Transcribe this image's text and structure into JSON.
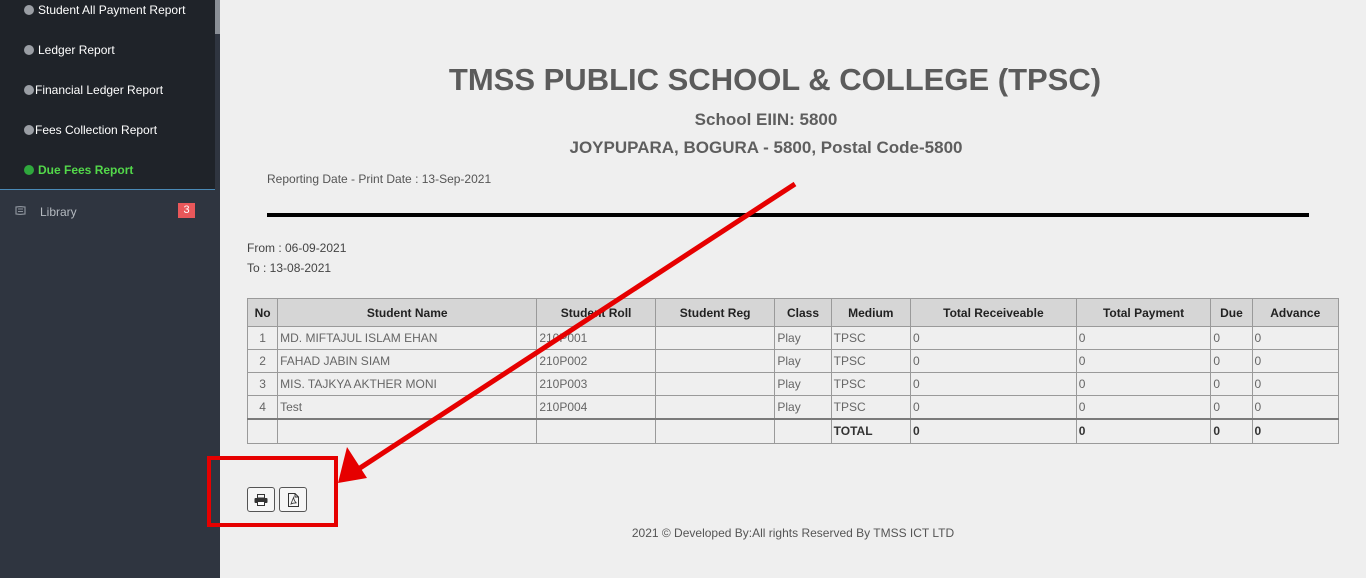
{
  "sidebar": {
    "submenu": [
      {
        "label": "Student All Payment Report",
        "active": false
      },
      {
        "label": "Ledger Report",
        "active": false
      },
      {
        "label": "Financial Ledger Report",
        "active": false
      },
      {
        "label": "Fees Collection Report",
        "active": false
      },
      {
        "label": "Due Fees Report",
        "active": true
      }
    ],
    "library": {
      "label": "Library",
      "icon": "book-icon",
      "badge": "3"
    }
  },
  "report": {
    "school_name": "TMSS PUBLIC SCHOOL & COLLEGE (TPSC)",
    "eiin": "School EIIN: 5800",
    "address": "JOYPUPARA, BOGURA - 5800, Postal Code-5800",
    "reporting_date": "Reporting Date - Print Date : 13-Sep-2021",
    "from": "From : 06-09-2021",
    "to": "To : 13-08-2021"
  },
  "table": {
    "columns": [
      "No",
      "Student Name",
      "Student Roll",
      "Student Reg",
      "Class",
      "Medium",
      "Total Receiveable",
      "Total Payment",
      "Due",
      "Advance"
    ],
    "rows": [
      {
        "no": "1",
        "name": "MD. MIFTAJUL ISLAM EHAN",
        "roll": "210P001",
        "reg": "",
        "class": "Play",
        "medium": "TPSC",
        "receivable": "0",
        "payment": "0",
        "due": "0",
        "advance": "0"
      },
      {
        "no": "2",
        "name": "FAHAD JABIN SIAM",
        "roll": "210P002",
        "reg": "",
        "class": "Play",
        "medium": "TPSC",
        "receivable": "0",
        "payment": "0",
        "due": "0",
        "advance": "0"
      },
      {
        "no": "3",
        "name": "MIS. TAJKYA AKTHER MONI",
        "roll": "210P003",
        "reg": "",
        "class": "Play",
        "medium": "TPSC",
        "receivable": "0",
        "payment": "0",
        "due": "0",
        "advance": "0"
      },
      {
        "no": "4",
        "name": "Test",
        "roll": "210P004",
        "reg": "",
        "class": "Play",
        "medium": "TPSC",
        "receivable": "0",
        "payment": "0",
        "due": "0",
        "advance": "0"
      }
    ],
    "total": {
      "label": "TOTAL",
      "receivable": "0",
      "payment": "0",
      "due": "0",
      "advance": "0"
    }
  },
  "buttons": {
    "print_icon": "printer-icon",
    "pdf_icon": "pdf-file-icon"
  },
  "annotation": {
    "color": "#e60000"
  },
  "footer": "2021 © Developed By:All rights Reserved By TMSS ICT LTD",
  "colors": {
    "sidebar_bg": "#2f3540",
    "submenu_bg": "#1f2329",
    "active_green": "#53d84a",
    "badge_red": "#e9575a"
  }
}
